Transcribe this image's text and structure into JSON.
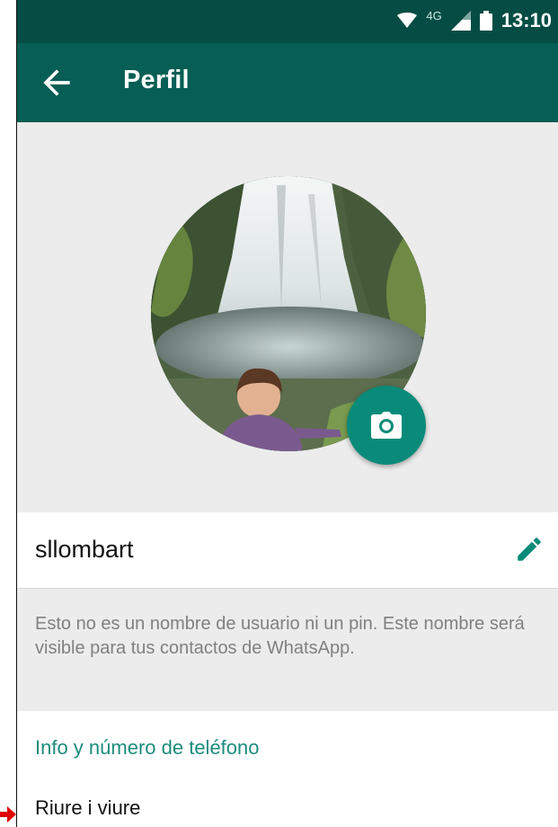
{
  "status_bar": {
    "network_type": "4G",
    "time": "13:10",
    "icons": [
      "wifi-icon",
      "signal-icon",
      "battery-icon"
    ]
  },
  "toolbar": {
    "title": "Perfil",
    "back_icon": "arrow-left-icon"
  },
  "profile": {
    "name": "sllombart",
    "hint": "Esto no es un nombre de usuario ni un pin. Este nombre será visible para tus contactos de WhatsApp.",
    "info_section_title": "Info y número de teléfono",
    "about": "Riure i viure",
    "camera_icon": "camera-icon",
    "edit_icon": "pencil-icon"
  },
  "colors": {
    "status_bar": "#054d44",
    "toolbar": "#075e54",
    "accent": "#1c8c7b",
    "fab": "#0a8b79",
    "background": "#ececec",
    "annotation_arrow": "#e00000"
  }
}
